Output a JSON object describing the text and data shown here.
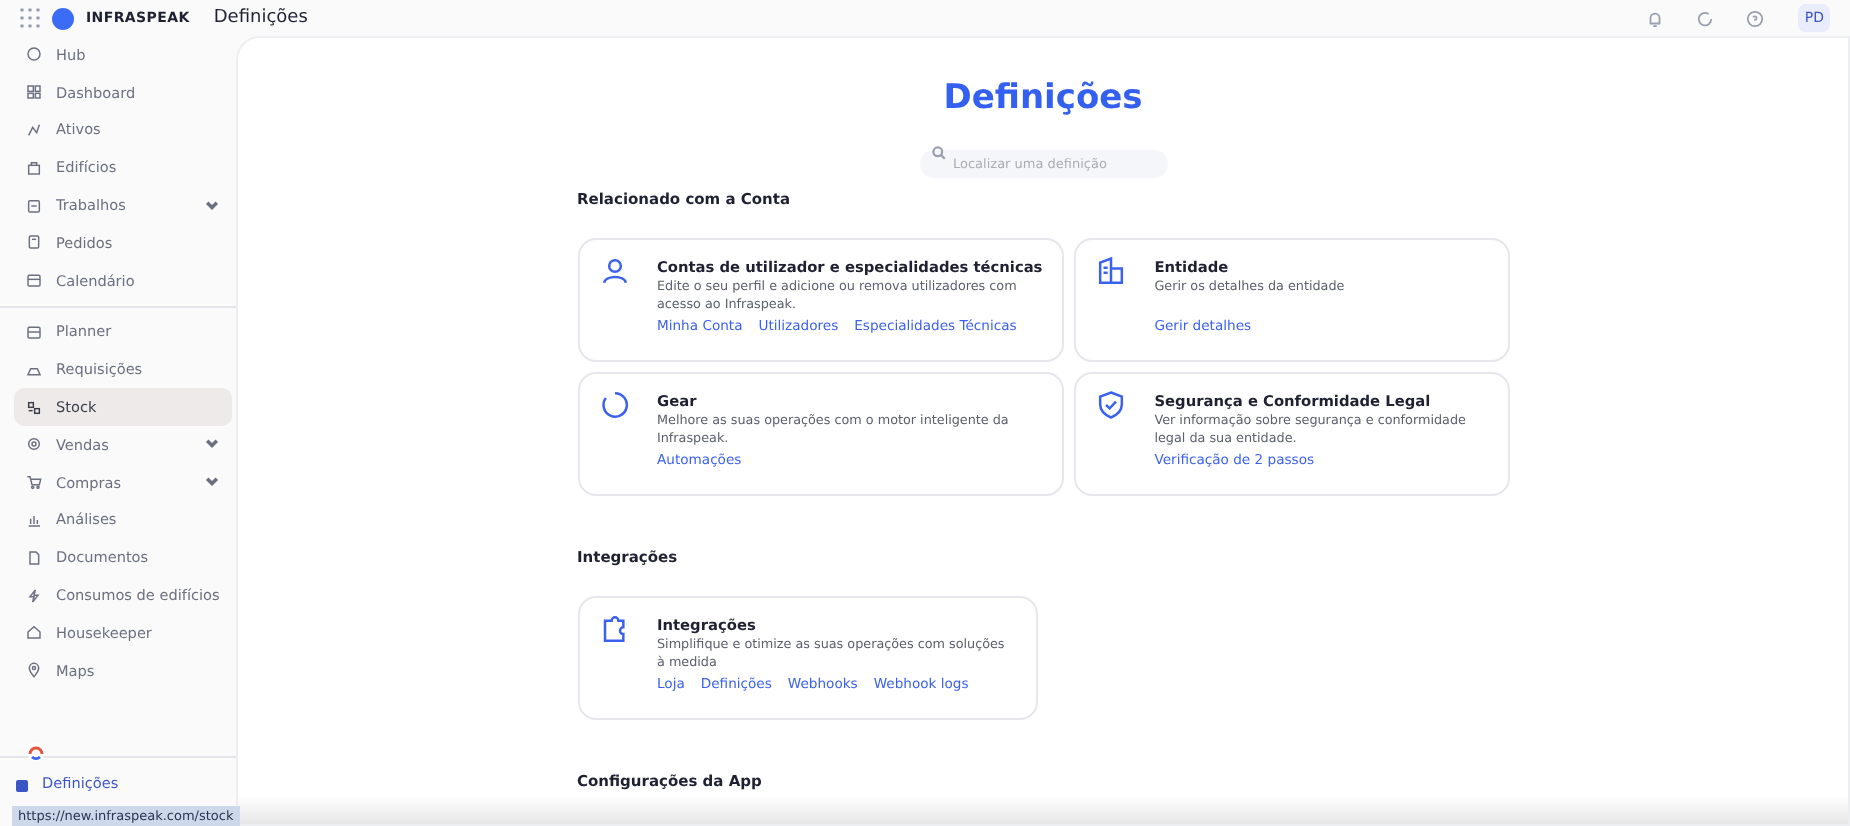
{
  "topbar": {
    "brand": "INFRASPEAK",
    "page_title": "Definições",
    "avatar": "PD"
  },
  "sidebar": {
    "groups": [
      {
        "items": [
          {
            "label": "Hub",
            "kind": "link",
            "selected": false
          },
          {
            "label": "Dashboard",
            "kind": "link",
            "selected": false
          },
          {
            "label": "Ativos",
            "kind": "link",
            "selected": false
          },
          {
            "label": "Edifícios",
            "kind": "link",
            "selected": false
          },
          {
            "label": "Trabalhos",
            "kind": "menu",
            "selected": false
          },
          {
            "label": "Pedidos",
            "kind": "link",
            "selected": false
          },
          {
            "label": "Calendário",
            "kind": "link",
            "selected": false
          }
        ]
      },
      {
        "items": [
          {
            "label": "Planner",
            "kind": "link",
            "selected": false
          },
          {
            "label": "Requisições",
            "kind": "link",
            "selected": false
          },
          {
            "label": "Stock",
            "kind": "link",
            "selected": true
          },
          {
            "label": "Vendas",
            "kind": "menu",
            "selected": false
          },
          {
            "label": "Compras",
            "kind": "menu",
            "selected": false
          },
          {
            "label": "Análises",
            "kind": "link",
            "selected": false
          },
          {
            "label": "Documentos",
            "kind": "link",
            "selected": false
          },
          {
            "label": "Consumos de edifícios",
            "kind": "link",
            "selected": false
          },
          {
            "label": "Housekeeper",
            "kind": "link",
            "selected": false
          },
          {
            "label": "Maps",
            "kind": "link",
            "selected": false
          }
        ]
      }
    ],
    "footer_item": {
      "label": "Definições"
    }
  },
  "status_url": "https://new.infraspeak.com/stock",
  "main": {
    "title": "Definições",
    "search": {
      "placeholder": "Localizar uma definição"
    },
    "sections": [
      {
        "title": "Relacionado com a Conta",
        "cards": [
          {
            "title": "Contas de utilizador e especialidades técnicas",
            "description": "Edite o seu perfil e adicione ou remova utilizadores com acesso ao Infraspeak.",
            "links": [
              "Minha Conta",
              "Utilizadores",
              "Especialidades Técnicas"
            ]
          },
          {
            "title": "Entidade",
            "description": "Gerir os detalhes da entidade",
            "links": [
              "Gerir detalhes"
            ]
          },
          {
            "title": "Gear",
            "description": "Melhore as suas operações com o motor inteligente da Infraspeak.",
            "links": [
              "Automações"
            ]
          },
          {
            "title": "Segurança e Conformidade Legal",
            "description": "Ver informação sobre segurança e conformidade legal da sua entidade.",
            "links": [
              "Verificação de 2 passos"
            ]
          }
        ]
      },
      {
        "title": "Integrações",
        "cards": [
          {
            "title": "Integrações",
            "description": "Simplifique e otimize as suas operações com soluções à medida",
            "links": [
              "Loja",
              "Definições",
              "Webhooks",
              "Webhook logs"
            ]
          }
        ]
      },
      {
        "title": "Configurações da App"
      }
    ]
  }
}
